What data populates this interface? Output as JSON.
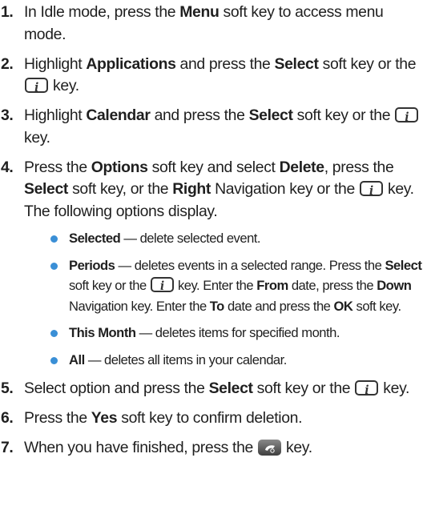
{
  "steps": [
    {
      "num": "1.",
      "parts": [
        {
          "t": "In Idle mode, press the "
        },
        {
          "b": "Menu"
        },
        {
          "t": " soft key to access menu mode."
        }
      ]
    },
    {
      "num": "2.",
      "parts": [
        {
          "t": "Highlight "
        },
        {
          "b": "Applications"
        },
        {
          "t": " and press the "
        },
        {
          "b": "Select"
        },
        {
          "t": " soft key or the "
        },
        {
          "icon": "info-key"
        },
        {
          "t": " key."
        }
      ]
    },
    {
      "num": "3.",
      "parts": [
        {
          "t": "Highlight "
        },
        {
          "b": "Calendar"
        },
        {
          "t": " and press the "
        },
        {
          "b": "Select"
        },
        {
          "t": " soft key or the "
        },
        {
          "icon": "info-key"
        },
        {
          "t": " key."
        }
      ]
    },
    {
      "num": "4.",
      "parts": [
        {
          "t": "Press the "
        },
        {
          "b": "Options"
        },
        {
          "t": " soft key and select "
        },
        {
          "b": "Delete"
        },
        {
          "t": ", press the "
        },
        {
          "b": "Select"
        },
        {
          "t": " soft key, or the "
        },
        {
          "b": "Right"
        },
        {
          "t": " Navigation key or the "
        },
        {
          "icon": "info-key"
        },
        {
          "t": " key. The following options display."
        }
      ],
      "subs": [
        [
          {
            "b": "Selected"
          },
          {
            "t": " — delete selected event."
          }
        ],
        [
          {
            "b": "Periods"
          },
          {
            "t": " — deletes events in a selected range. Press the "
          },
          {
            "b": "Select"
          },
          {
            "t": " soft key or the "
          },
          {
            "icon": "info-key"
          },
          {
            "t": " key. Enter the "
          },
          {
            "b": "From"
          },
          {
            "t": " date, press the "
          },
          {
            "b": "Down"
          },
          {
            "t": " Navigation key. Enter the "
          },
          {
            "b": "To"
          },
          {
            "t": " date and press the "
          },
          {
            "b": "OK"
          },
          {
            "t": " soft key."
          }
        ],
        [
          {
            "b": "This Month"
          },
          {
            "t": " — deletes items for specified month."
          }
        ],
        [
          {
            "b": "All"
          },
          {
            "t": " — deletes all items in your calendar."
          }
        ]
      ]
    },
    {
      "num": "5.",
      "parts": [
        {
          "t": "Select option and press the "
        },
        {
          "b": "Select"
        },
        {
          "t": " soft key or the "
        },
        {
          "icon": "info-key"
        },
        {
          "t": " key."
        }
      ]
    },
    {
      "num": "6.",
      "parts": [
        {
          "t": "Press the "
        },
        {
          "b": "Yes"
        },
        {
          "t": " soft key to confirm deletion."
        }
      ]
    },
    {
      "num": "7.",
      "parts": [
        {
          "t": "When you have finished, press the "
        },
        {
          "icon": "end-key"
        },
        {
          "t": " key."
        }
      ]
    }
  ],
  "colors": {
    "text": "#1f1f1f",
    "bullet": "#3a8fd6",
    "key_border": "#333333"
  }
}
